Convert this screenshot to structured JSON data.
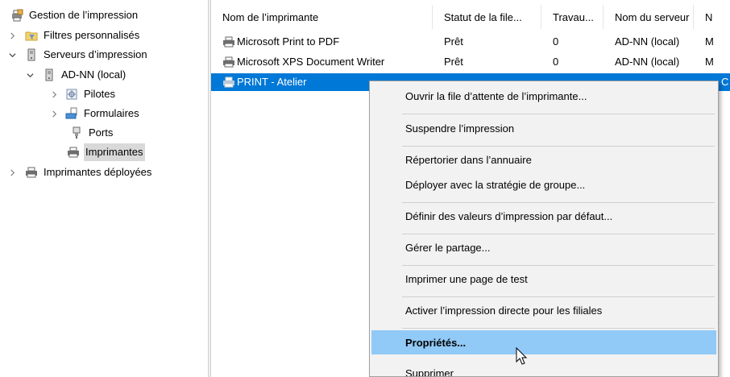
{
  "tree": {
    "root": "Gestion de l’impression",
    "custom_filters": "Filtres personnalisés",
    "print_servers": "Serveurs d’impression",
    "server": "AD-NN (local)",
    "drivers": "Pilotes",
    "forms": "Formulaires",
    "ports": "Ports",
    "printers": "Imprimantes",
    "deployed_printers": "Imprimantes déployées"
  },
  "list": {
    "columns": [
      "Nom de l’imprimante",
      "Statut de la file...",
      "Travau...",
      "Nom du serveur",
      "N"
    ],
    "rows": [
      [
        "Microsoft Print to PDF",
        "Prêt",
        "0",
        "AD-NN (local)",
        "M"
      ],
      [
        "Microsoft XPS Document Writer",
        "Prêt",
        "0",
        "AD-NN (local)",
        "M"
      ],
      [
        "PRINT - Atelier",
        "",
        "",
        "",
        "C"
      ]
    ]
  },
  "context_menu": {
    "open_queue": "Ouvrir la file d’attente de l’imprimante...",
    "pause": "Suspendre l’impression",
    "list_directory": "Répertorier dans l’annuaire",
    "deploy_gpo": "Déployer avec la stratégie de groupe...",
    "set_defaults": "Définir des valeurs d’impression par défaut...",
    "manage_sharing": "Gérer le partage...",
    "print_test": "Imprimer une page de test",
    "direct_printing": "Activer l’impression directe pour les filiales",
    "properties": "Propriétés...",
    "delete": "Supprimer"
  },
  "colors": {
    "selection": "#0078d7",
    "menu_hover": "#91c9f7",
    "menu_bg": "#f2f2f2",
    "tree_selected": "#d9d9d9"
  }
}
